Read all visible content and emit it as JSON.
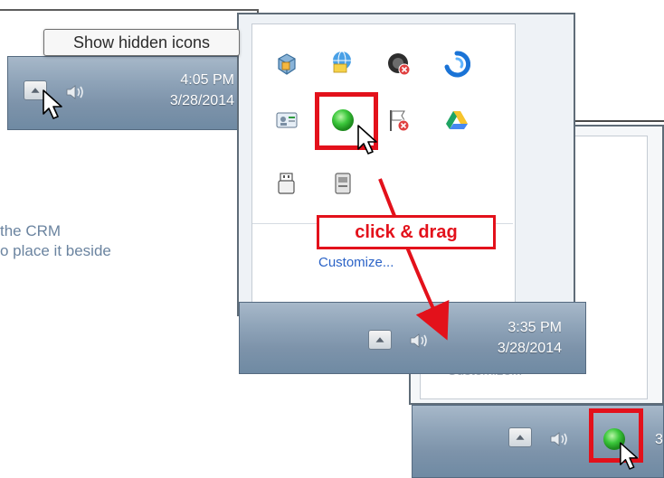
{
  "tooltip": {
    "text": "Show hidden icons"
  },
  "instructions": {
    "line1": "the CRM",
    "line2": "o place it beside"
  },
  "taskbar_top": {
    "time": "4:05 PM",
    "date": "3/28/2014"
  },
  "taskbar_mid": {
    "time": "3:35 PM",
    "date": "3/28/2014"
  },
  "overflow_panel": {
    "customize": "Customize..."
  },
  "back_panel": {
    "customize": "Customize..."
  },
  "callout": {
    "text": "click & drag"
  },
  "taskbar_bottom": {
    "clock_partial": "3"
  },
  "colors": {
    "highlight": "#e3111b",
    "link": "#2b63c7",
    "taskbar": "#7d93aa",
    "crm_icon_green": "#3cc83c"
  },
  "icons": [
    "vmware-icon",
    "network-drive-icon",
    "stop-media-icon",
    "blue-swirl-icon",
    "id-card-icon",
    "crm-green-dot-icon",
    "flag-error-icon",
    "google-drive-icon",
    "usb-device-icon",
    "removable-drive-icon"
  ]
}
